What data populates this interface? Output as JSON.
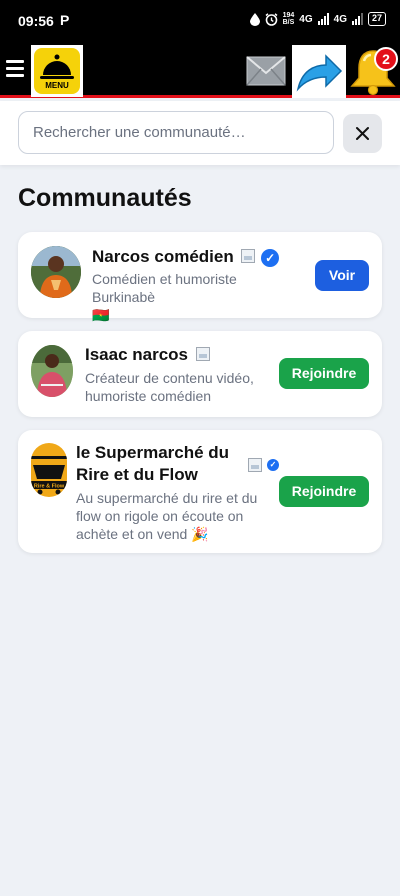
{
  "status_bar": {
    "time": "09:56",
    "notif_letter": "P",
    "speed_value": "194",
    "speed_unit": "B/S",
    "net1": "4G",
    "net2": "4G",
    "battery": "27"
  },
  "header": {
    "menu_label": "MENU",
    "notification_count": "2",
    "colors": {
      "background": "#000000",
      "accent_line": "#e3101a",
      "menu_yellow": "#f5d20a",
      "badge_red": "#e3101a"
    },
    "icons": [
      "hamburger-icon",
      "menu-cloche-icon",
      "mail-icon",
      "share-arrow-icon",
      "bell-icon"
    ]
  },
  "search": {
    "placeholder": "Rechercher une communauté…",
    "value": ""
  },
  "section": {
    "title": "Communautés"
  },
  "communities": [
    {
      "name": "Narcos comédien",
      "description": "Comédien et humoriste Burkinabè",
      "flag": "🇧🇫",
      "verified": true,
      "button": "Voir"
    },
    {
      "name": "Isaac narcos",
      "description_line1": "Créateur de contenu vidéo,",
      "description_line2": "humoriste comédien",
      "verified": false,
      "button": "Rejoindre"
    },
    {
      "name_line1": "le Supermarché du",
      "name_line2": "Rire et du Flow",
      "description_line1": "Au supermarché du rire et du",
      "description_line2": "flow on rigole on écoute on",
      "description_line3": "achète et on vend 🎉",
      "logo_text": "Rire & Flow",
      "verified": true,
      "button": "Rejoindre"
    }
  ],
  "colors": {
    "page_background": "#eef1f6",
    "primary_blue": "#1d5fe0",
    "join_green": "#1aa34a",
    "verified_blue": "#1d6ff2"
  }
}
